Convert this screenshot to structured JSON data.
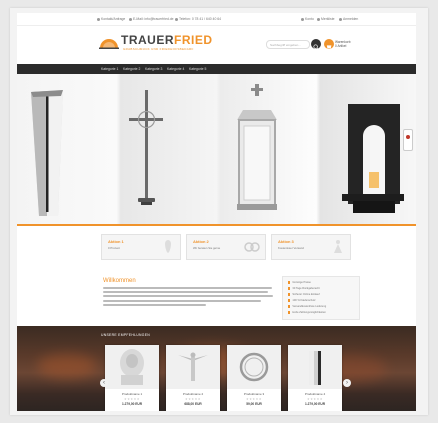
{
  "topbar": {
    "items_left": [
      "Kontakt/Anfrage",
      "E-Mail: info@trauerfried.de",
      "Telefon: 0 78 41 / 640 40 64"
    ],
    "items_right": [
      "Konto",
      "Merkliste",
      "Anmelden"
    ]
  },
  "header": {
    "logo_text_1": "TRAUER",
    "logo_text_2": "FRIED",
    "tagline": "GRABSCHMUCK UND FRIEDHOFSBEDARF",
    "search_placeholder": "Suchbegriff eingeben...",
    "cart_label_1": "Warenkorb",
    "cart_label_2": "0 Artikel"
  },
  "nav": [
    "Kategorie 1",
    "Kategorie 2",
    "Kategorie 3",
    "Kategorie 4",
    "Kategorie 5"
  ],
  "promos": [
    {
      "title": "Aktion 1",
      "sub": "0 Prozent"
    },
    {
      "title": "Aktion 2",
      "sub": "Wir beraten Sie gerne"
    },
    {
      "title": "Aktion 3",
      "sub": "Kostenloser Versand"
    }
  ],
  "welcome": {
    "title": "Willkommen"
  },
  "features": [
    "Günstige Preise",
    "30 Tage Rückgaberecht",
    "Sicherer Online Einkauf",
    "100 % Käuferschutz",
    "Versandkostenfreie Lieferung",
    "Hohe Zahlungsmöglichkeiten"
  ],
  "section": {
    "label": "UNSERE EMPFEHLUNGEN"
  },
  "products": [
    {
      "name": "Produktname 1",
      "stars": "★★★★★",
      "price": "1.279,00 EUR"
    },
    {
      "name": "Produktname 2",
      "stars": "★★★★★",
      "price": "688,00 EUR"
    },
    {
      "name": "Produktname 3",
      "stars": "★★★★★",
      "price": "59,00 EUR"
    },
    {
      "name": "Produktname 4",
      "stars": "★★★★★",
      "price": "1.279,00 EUR"
    }
  ],
  "carousel": {
    "prev": "‹",
    "next": "›"
  },
  "colors": {
    "accent": "#f0932b",
    "nav": "#2b2b2b"
  }
}
